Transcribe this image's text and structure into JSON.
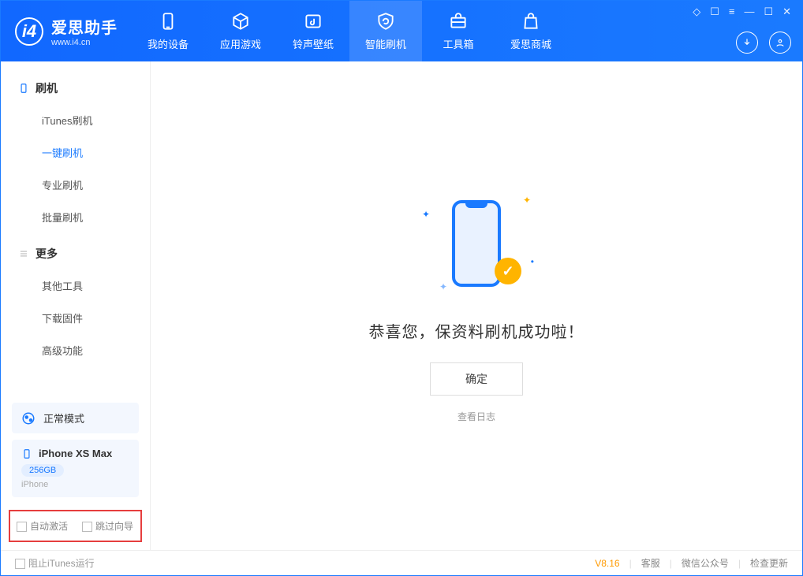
{
  "app": {
    "title": "爱思助手",
    "subtitle": "www.i4.cn"
  },
  "tabs": {
    "device": "我的设备",
    "apps": "应用游戏",
    "rings": "铃声壁纸",
    "flash": "智能刷机",
    "tools": "工具箱",
    "store": "爱思商城"
  },
  "sidebar": {
    "sec1": {
      "title": "刷机",
      "items": [
        "iTunes刷机",
        "一键刷机",
        "专业刷机",
        "批量刷机"
      ],
      "active": 1
    },
    "sec2": {
      "title": "更多",
      "items": [
        "其他工具",
        "下载固件",
        "高级功能"
      ]
    }
  },
  "mode": {
    "label": "正常模式"
  },
  "device": {
    "name": "iPhone XS Max",
    "storage": "256GB",
    "type": "iPhone"
  },
  "options": {
    "auto_activate": "自动激活",
    "skip_guide": "跳过向导"
  },
  "main": {
    "message": "恭喜您，保资料刷机成功啦！",
    "ok": "确定",
    "log": "查看日志"
  },
  "footer": {
    "block_itunes": "阻止iTunes运行",
    "version": "V8.16",
    "service": "客服",
    "wechat": "微信公众号",
    "update": "检查更新"
  }
}
